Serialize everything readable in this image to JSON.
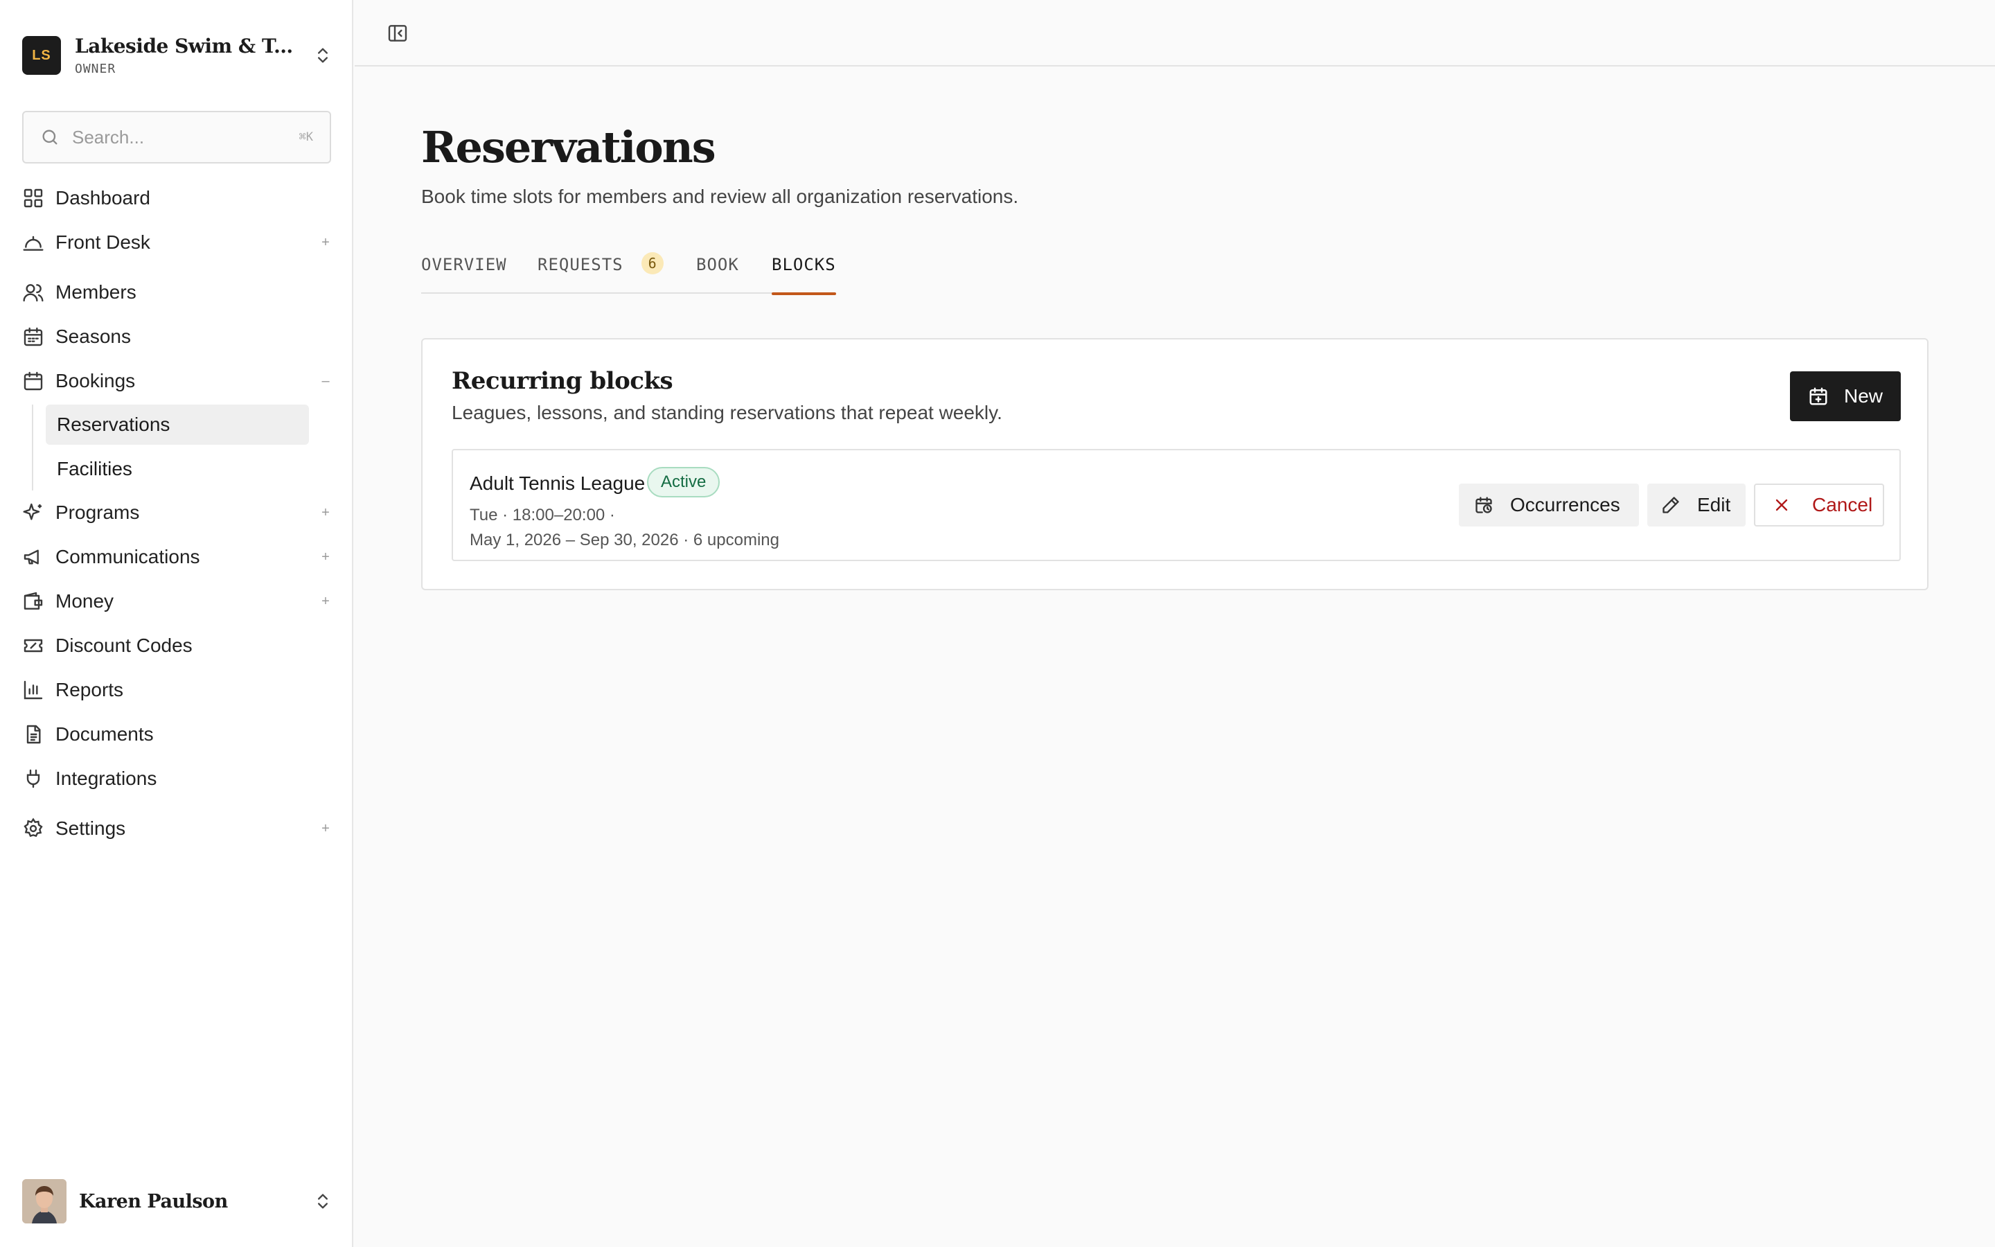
{
  "org": {
    "logo_initials": "LS",
    "name": "Lakeside Swim & Tennis Club",
    "role": "OWNER"
  },
  "search": {
    "placeholder": "Search...",
    "shortcut": "⌘K"
  },
  "sidebar": {
    "items": [
      {
        "label": "Dashboard",
        "icon": "dashboard-grid-icon",
        "expand": ""
      },
      {
        "label": "Front Desk",
        "icon": "service-bell-icon",
        "expand": "+"
      },
      {
        "label": "Members",
        "icon": "users-icon",
        "expand": ""
      },
      {
        "label": "Seasons",
        "icon": "calendar-icon",
        "expand": ""
      },
      {
        "label": "Bookings",
        "icon": "calendar-check-icon",
        "expand": "–"
      },
      {
        "label": "Programs",
        "icon": "sparkles-icon",
        "expand": "+"
      },
      {
        "label": "Communications",
        "icon": "megaphone-icon",
        "expand": "+"
      },
      {
        "label": "Money",
        "icon": "wallet-icon",
        "expand": "+"
      },
      {
        "label": "Discount Codes",
        "icon": "ticket-icon",
        "expand": ""
      },
      {
        "label": "Reports",
        "icon": "bar-chart-icon",
        "expand": ""
      },
      {
        "label": "Documents",
        "icon": "document-icon",
        "expand": ""
      },
      {
        "label": "Integrations",
        "icon": "plug-icon",
        "expand": ""
      },
      {
        "label": "Settings",
        "icon": "gear-icon",
        "expand": "+"
      }
    ],
    "bookings_children": [
      {
        "label": "Reservations",
        "active": true
      },
      {
        "label": "Facilities",
        "active": false
      }
    ]
  },
  "user": {
    "name": "Karen Paulson"
  },
  "page": {
    "title": "Reservations",
    "subtitle": "Book time slots for members and review all organization reservations."
  },
  "tabs": [
    {
      "label": "OVERVIEW",
      "active": false
    },
    {
      "label": "REQUESTS",
      "badge": "6",
      "active": false
    },
    {
      "label": "BOOK",
      "active": false
    },
    {
      "label": "BLOCKS",
      "active": true
    }
  ],
  "recurring": {
    "title": "Recurring blocks",
    "subtitle": "Leagues, lessons, and standing reservations that repeat weekly.",
    "new_label": "New",
    "blocks": [
      {
        "name": "Adult Tennis League",
        "status": "Active",
        "schedule": "Tue · 18:00–20:00 ·",
        "range": "May 1, 2026 – Sep 30, 2026 · 6 upcoming",
        "occurrences_label": "Occurrences",
        "edit_label": "Edit",
        "cancel_label": "Cancel"
      }
    ]
  },
  "colors": {
    "accent": "#c2571a",
    "primary_button": "#1c1c1c",
    "status_active": "#146c43",
    "danger": "#b01818",
    "badge_bg": "#fbe9b7"
  }
}
